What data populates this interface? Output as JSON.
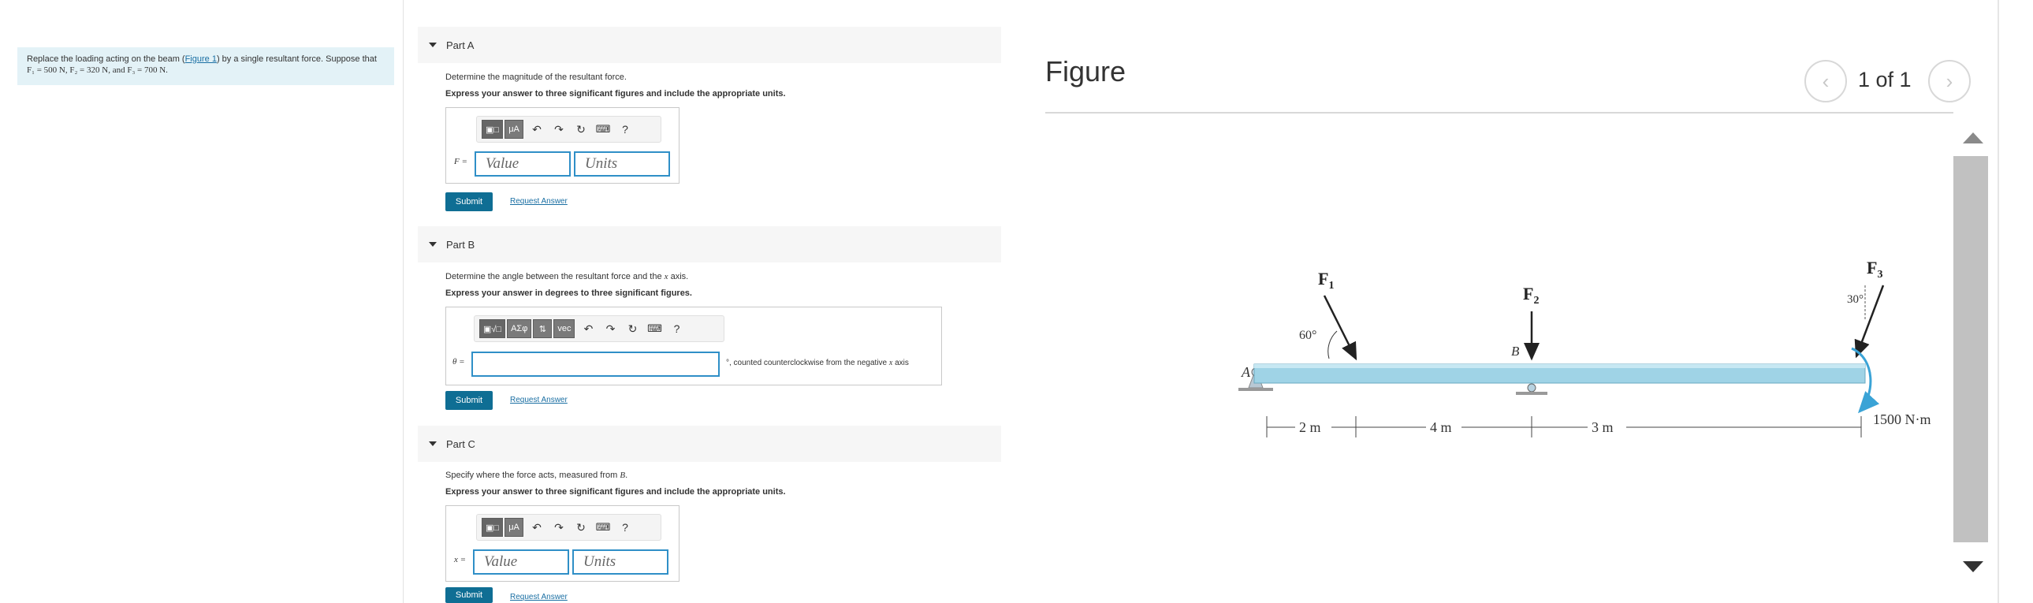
{
  "problem": {
    "pre": "Replace the loading acting on the beam (",
    "link": "Figure 1",
    "post": ") by a single resultant force. Suppose that",
    "line2": "F₁ = 500 N, F₂ = 320 N, and F₃ = 700 N."
  },
  "partA": {
    "title": "Part A",
    "prompt": "Determine the magnitude of the resultant force.",
    "instruction": "Express your answer to three significant figures and include the appropriate units.",
    "toolbar": {
      "templates": "▣□",
      "micro": "μA",
      "undo": "↶",
      "redo": "↷",
      "reset": "↻",
      "keyboard": "⌨",
      "help": "?"
    },
    "field_label": "F =",
    "value_placeholder": "Value",
    "units_placeholder": "Units",
    "submit": "Submit",
    "request": "Request Answer"
  },
  "partB": {
    "title": "Part B",
    "prompt_pre": "Determine the angle between the resultant force and the ",
    "prompt_var": "x",
    "prompt_post": " axis.",
    "instruction": "Express your answer in degrees to three significant figures.",
    "toolbar": {
      "templates": "▣√□",
      "greek": "AΣφ",
      "arrows": "⇅",
      "vec": "vec",
      "undo": "↶",
      "redo": "↷",
      "reset": "↻",
      "keyboard": "⌨",
      "help": "?"
    },
    "field_label": "θ =",
    "suffix_pre": "°, counted counterclockwise from the negative ",
    "suffix_var": "x",
    "suffix_post": " axis",
    "submit": "Submit",
    "request": "Request Answer"
  },
  "partC": {
    "title": "Part C",
    "prompt_pre": "Specify where the force acts, measured from ",
    "prompt_var": "B",
    "prompt_post": ".",
    "instruction": "Express your answer to three significant figures and include the appropriate units.",
    "toolbar": {
      "templates": "▣□",
      "micro": "μA",
      "undo": "↶",
      "redo": "↷",
      "reset": "↻",
      "keyboard": "⌨",
      "help": "?"
    },
    "field_label": "x =",
    "value_placeholder": "Value",
    "units_placeholder": "Units",
    "submit": "Submit",
    "request": "Request Answer"
  },
  "figure": {
    "title": "Figure",
    "page_indicator": "1 of 1",
    "prev_icon": "‹",
    "next_icon": "›",
    "diagram": {
      "f1_letter": "F",
      "f1_sub": "1",
      "f2_letter": "F",
      "f2_sub": "2",
      "f3_letter": "F",
      "f3_sub": "3",
      "angle1": "60°",
      "angle3": "30°",
      "point_a": "A",
      "point_b": "B",
      "dim1": "2 m",
      "dim2": "4 m",
      "dim3": "3 m",
      "moment": "1500 N·m"
    }
  },
  "colors": {
    "accent": "#0f6e94",
    "input_border": "#2f8fc7",
    "beam": "#9fd3e6",
    "problem_bg": "#e3f2f7",
    "moment_arrow": "#3aa3d6"
  }
}
